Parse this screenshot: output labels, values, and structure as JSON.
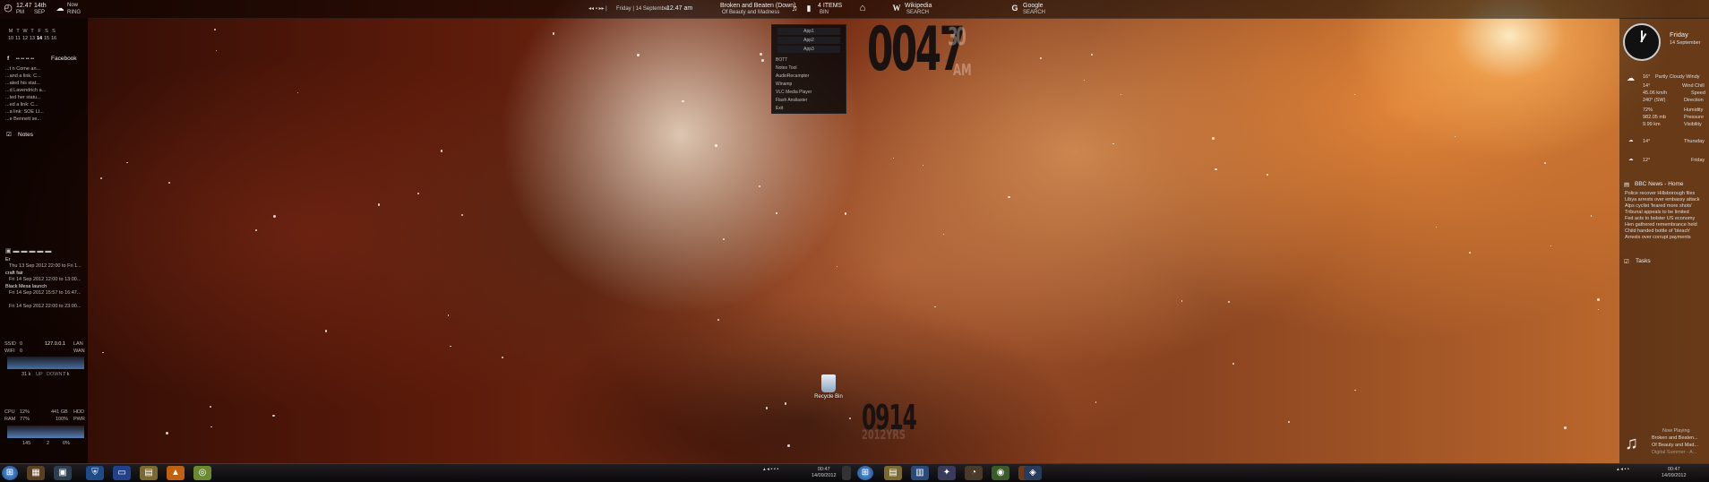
{
  "topbar": {
    "clock_time": "12.47",
    "clock_ampm": "PM",
    "date_day": "14th",
    "date_month": "SEP",
    "weather_label": "Now",
    "weather_sub": "RING",
    "media_sub": "Friday | 14 September",
    "media_time": "12.47 am",
    "now_playing_title": "Broken and Beaten (Down)",
    "now_playing_artist": "Of Beauty and Madness",
    "bin_items": "4 ITEMS",
    "bin_label": "BIN",
    "wiki_label": "Wikipedia",
    "wiki_sub": "SEARCH",
    "google_label": "Google",
    "google_sub": "SEARCH"
  },
  "left": {
    "calendar_days": [
      "M",
      "T",
      "W",
      "T",
      "F",
      "S",
      "S"
    ],
    "calendar_dates": [
      "10",
      "11",
      "12",
      "13",
      "14",
      "15",
      "16"
    ],
    "facebook_title": "Facebook",
    "facebook_lines": [
      "...t n Come an...",
      "...and a link. C...",
      "...ated his stat...",
      "...d Lavendrich a...",
      "...ted her statu...",
      "...ed a link: C...",
      "...a link: SOE LI...",
      "...e Bennett se..."
    ],
    "notes_title": "Notes",
    "events": [
      {
        "title": "Er",
        "time": "Thu 13 Sep 2012 22:00 to Fri 1..."
      },
      {
        "title": "craft fair",
        "time": "Fri 14 Sep 2012 12:00 to 13:00..."
      },
      {
        "title": "Black Mesa launch",
        "time": "Fri 14 Sep 2012 15:57 to 16:47..."
      },
      {
        "title": "",
        "time": "Fri 14 Sep 2012 22:00 to 23:00..."
      }
    ],
    "net": {
      "ssid_label": "SSID",
      "ssid_val": "0",
      "ip": "127.0.0.1",
      "lan_label": "LAN",
      "wifi_label": "WIFI",
      "wifi_val": "0",
      "wan_label": "WAN",
      "down": "31 k",
      "up_label": "UP",
      "down_label": "DOWN",
      "up": "7 k"
    },
    "sys": {
      "cpu_label": "CPU",
      "cpu_val": "12%",
      "hdd_val": "441 GB",
      "hdd_label": "HDD",
      "ram_label": "RAM",
      "ram_val": "77%",
      "pwr_val": "100%",
      "pwr_label": "PWR",
      "n1": "145",
      "n2": "2",
      "n3": "0%"
    }
  },
  "right": {
    "day": "Friday",
    "date": "14 September",
    "weather_desc": "Partly Cloudy Windy",
    "rows": [
      {
        "val": "16°",
        "label": "Partly Cloudy Windy"
      },
      {
        "val": "14°",
        "label": "Wind Chill"
      },
      {
        "val": "45.06 km/h",
        "label": "Speed"
      },
      {
        "val": "240° (SW)",
        "label": "Direction"
      },
      {
        "val": "72%",
        "label": "Humidity"
      },
      {
        "val": "982.05 mb",
        "label": "Pressure"
      },
      {
        "val": "9.99 km",
        "label": "Visibility"
      }
    ],
    "forecast": [
      {
        "val": "14°",
        "label": "Thursday"
      },
      {
        "val": "12°",
        "label": "Friday"
      }
    ],
    "news_title": "BBC News - Home",
    "news_items": [
      "Police recover Hillsborough files",
      "Libya arrests over embassy attack",
      "Alps cyclist 'feared more shots'",
      "Tribunal appeals to be limited",
      "Fed acts to bolster US economy",
      "Hen gathered remembrance held",
      "Child handed bottle of 'bleach'",
      "Arrests over corrupt payments"
    ],
    "tasks_title": "Tasks",
    "now_playing_label": "Now Playing",
    "np_title": "Broken and Beaten...",
    "np_album": "Of Beauty and Mad...",
    "np_artist": "Digital Summer - A..."
  },
  "center": {
    "clock_hm": "0047",
    "clock_sec": "30",
    "clock_ampm": "AM",
    "date_dm": "0914",
    "date_year": "2012YRS"
  },
  "launcher": {
    "apps": [
      "App1",
      "App2",
      "App3"
    ],
    "items": [
      "BOTT",
      "Notes Tool",
      "AudioRecamptor",
      "Winamp",
      "VLC Media Player",
      "Flash Ansliaster",
      "Exit"
    ]
  },
  "desktop": {
    "recycle_label": "Recycle Bin"
  },
  "taskbar": {
    "center_time": "00:47",
    "center_date": "14/09/2012",
    "tray_time": "00:47",
    "tray_date": "14/09/2012",
    "accent": "#1e4a8a"
  }
}
